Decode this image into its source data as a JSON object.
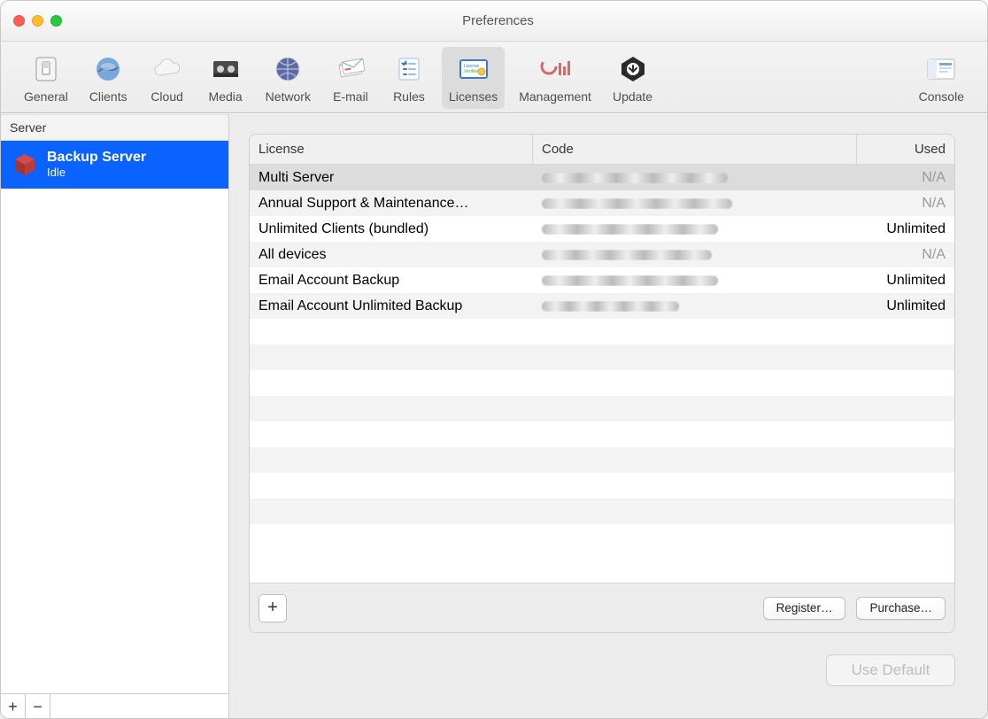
{
  "window": {
    "title": "Preferences"
  },
  "traffic": {
    "close": "close",
    "minimize": "minimize",
    "zoom": "zoom"
  },
  "toolbar": {
    "items": [
      {
        "label": "General",
        "name": "toolbar-item-general"
      },
      {
        "label": "Clients",
        "name": "toolbar-item-clients"
      },
      {
        "label": "Cloud",
        "name": "toolbar-item-cloud"
      },
      {
        "label": "Media",
        "name": "toolbar-item-media"
      },
      {
        "label": "Network",
        "name": "toolbar-item-network"
      },
      {
        "label": "E-mail",
        "name": "toolbar-item-email"
      },
      {
        "label": "Rules",
        "name": "toolbar-item-rules"
      },
      {
        "label": "Licenses",
        "name": "toolbar-item-licenses"
      },
      {
        "label": "Management",
        "name": "toolbar-item-management"
      },
      {
        "label": "Update",
        "name": "toolbar-item-update"
      },
      {
        "label": "Console",
        "name": "toolbar-item-console"
      }
    ],
    "active_index": 7
  },
  "sidebar": {
    "header": "Server",
    "server": {
      "title": "Backup Server",
      "subtitle": "Idle"
    },
    "footer": {
      "add": "+",
      "remove": "−"
    }
  },
  "table": {
    "headers": {
      "license": "License",
      "code": "Code",
      "used": "Used"
    },
    "rows": [
      {
        "license": "Multi Server",
        "code": "",
        "used": "N/A",
        "na": true,
        "selected": true
      },
      {
        "license": "Annual Support & Maintenance…",
        "code": "",
        "used": "N/A",
        "na": true
      },
      {
        "license": "Unlimited Clients (bundled)",
        "code": "",
        "used": "Unlimited"
      },
      {
        "license": "All devices",
        "code": "",
        "used": "N/A",
        "na": true
      },
      {
        "license": "Email Account Backup",
        "code": "",
        "used": "Unlimited"
      },
      {
        "license": "Email Account Unlimited Backup",
        "code": "",
        "used": "Unlimited"
      }
    ],
    "empty_filler_rows": 8
  },
  "buttons": {
    "add": "+",
    "register": "Register…",
    "purchase": "Purchase…",
    "use_default": "Use Default"
  }
}
